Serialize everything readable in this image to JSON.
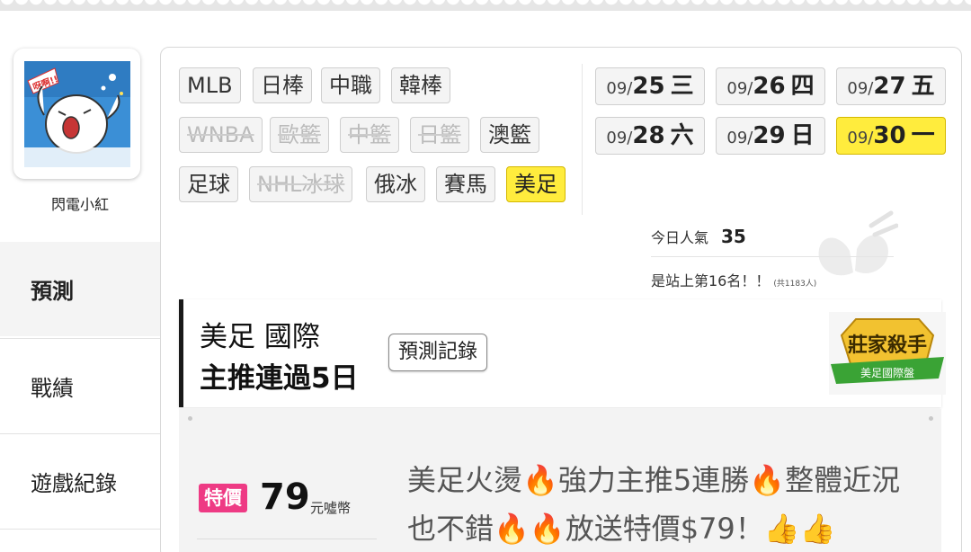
{
  "user": {
    "name": "閃電小紅",
    "avatar": "cartoon-avatar-icon"
  },
  "sidebar": {
    "items": [
      {
        "label": "預測",
        "active": true
      },
      {
        "label": "戰績",
        "active": false
      },
      {
        "label": "遊戲紀錄",
        "active": false
      },
      {
        "label": "",
        "active": false
      }
    ]
  },
  "sports": [
    {
      "label": "MLB",
      "state": "normal"
    },
    {
      "label": "日棒",
      "state": "normal"
    },
    {
      "label": "中職",
      "state": "normal"
    },
    {
      "label": "韓棒",
      "state": "normal"
    },
    {
      "label": "WNBA",
      "state": "disabled"
    },
    {
      "label": "歐籃",
      "state": "disabled"
    },
    {
      "label": "中籃",
      "state": "disabled"
    },
    {
      "label": "日籃",
      "state": "disabled"
    },
    {
      "label": "澳籃",
      "state": "normal"
    },
    {
      "label": "足球",
      "state": "normal"
    },
    {
      "label": "NHL冰球",
      "state": "disabled"
    },
    {
      "label": "俄冰",
      "state": "normal"
    },
    {
      "label": "賽馬",
      "state": "normal"
    },
    {
      "label": "美足",
      "state": "selected"
    }
  ],
  "dates": [
    {
      "month": "09/",
      "day": "25",
      "weekday": "三",
      "selected": false
    },
    {
      "month": "09/",
      "day": "26",
      "weekday": "四",
      "selected": false
    },
    {
      "month": "09/",
      "day": "27",
      "weekday": "五",
      "selected": false
    },
    {
      "month": "09/",
      "day": "28",
      "weekday": "六",
      "selected": false
    },
    {
      "month": "09/",
      "day": "29",
      "weekday": "日",
      "selected": false
    },
    {
      "month": "09/",
      "day": "30",
      "weekday": "一",
      "selected": true
    }
  ],
  "popularity": {
    "label": "今日人氣",
    "value": "35",
    "rank_text": "是站上第16名！！",
    "total_text": "(共1183人)"
  },
  "tip": {
    "title_line1": "美足 國際",
    "title_line2": "主推連過5日",
    "record_button": "預測記錄",
    "badge_title": "莊家殺手",
    "badge_sub": "美足國際盤"
  },
  "price": {
    "tag": "特價",
    "amount": "79",
    "unit": "元噓幣"
  },
  "description": {
    "part1": "美足火燙",
    "part2": "強力主推5連勝",
    "part3": "整體近況也不錯",
    "part4": "放送特價$79！"
  },
  "colors": {
    "highlight": "#ffec3d",
    "sale": "#ee3a84",
    "badge_green": "#3aa335",
    "badge_gold": "#f2c230",
    "flame": "#f26b1d"
  }
}
